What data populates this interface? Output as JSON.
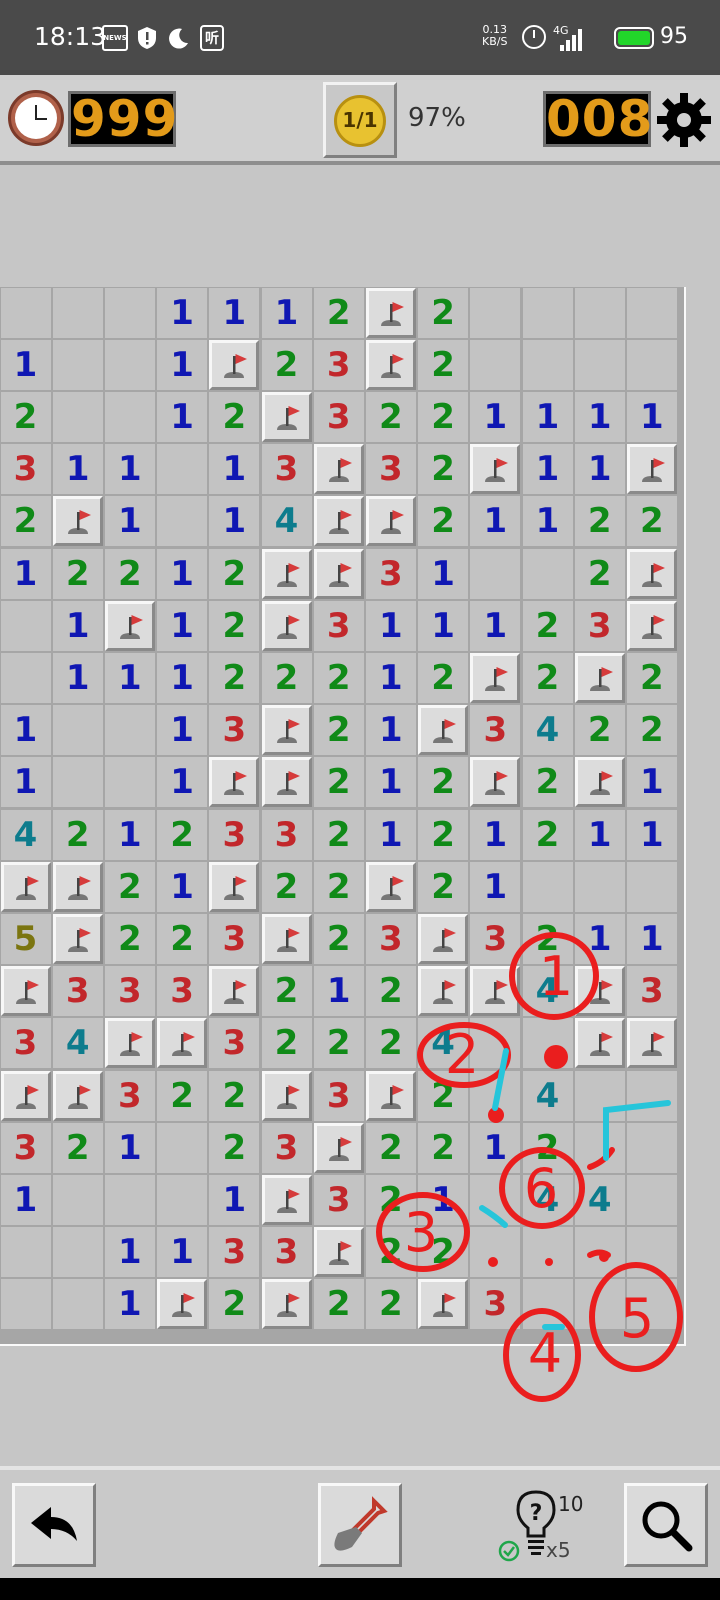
{
  "status_bar": {
    "time": "18:13",
    "news_label": "NEWS",
    "ting_label": "听",
    "net_speed_value": "0.13",
    "net_speed_unit": "KB/S",
    "network_type": "4G",
    "battery": "95"
  },
  "header": {
    "timer": "999",
    "face_label": "1/1",
    "progress": "97%",
    "mines_remaining": "008"
  },
  "colors": {
    "1": "#0f17b3",
    "2": "#108a18",
    "3": "#c2272b",
    "4": "#0d7c8d",
    "5": "#7b7510",
    "lcd_digits": "#e39b1a",
    "annotation_red": "#ea1e1e",
    "annotation_cyan": "#26c5da"
  },
  "board": {
    "rows": [
      [
        "",
        "",
        "",
        "1",
        "1",
        "1",
        "2",
        "F",
        "2",
        "",
        "",
        "",
        ""
      ],
      [
        "1",
        "",
        "",
        "1",
        "F",
        "2",
        "3",
        "F",
        "2",
        "",
        "",
        "",
        ""
      ],
      [
        "2",
        "",
        "",
        "1",
        "2",
        "F",
        "3",
        "2",
        "2",
        "1",
        "1",
        "1",
        "1"
      ],
      [
        "3",
        "1",
        "1",
        "",
        "1",
        "3",
        "F",
        "3",
        "2",
        "F",
        "1",
        "1",
        "F"
      ],
      [
        "2",
        "F",
        "1",
        "",
        "1",
        "4",
        "F",
        "F",
        "2",
        "1",
        "1",
        "2",
        "2"
      ],
      [
        "1",
        "2",
        "2",
        "1",
        "2",
        "F",
        "F",
        "3",
        "1",
        "",
        "",
        "2",
        "F"
      ],
      [
        "",
        "1",
        "F",
        "1",
        "2",
        "F",
        "3",
        "1",
        "1",
        "1",
        "2",
        "3",
        "F"
      ],
      [
        "",
        "1",
        "1",
        "1",
        "2",
        "2",
        "2",
        "1",
        "2",
        "F",
        "2",
        "F",
        "2"
      ],
      [
        "1",
        "",
        "",
        "1",
        "3",
        "F",
        "2",
        "1",
        "F",
        "3",
        "4",
        "2",
        "2"
      ],
      [
        "1",
        "",
        "",
        "1",
        "F",
        "F",
        "2",
        "1",
        "2",
        "F",
        "2",
        "F",
        "1"
      ],
      [
        "4",
        "2",
        "1",
        "2",
        "3",
        "3",
        "2",
        "1",
        "2",
        "1",
        "2",
        "1",
        "1"
      ],
      [
        "F",
        "F",
        "2",
        "1",
        "F",
        "2",
        "2",
        "F",
        "2",
        "1",
        "",
        "",
        ""
      ],
      [
        "5",
        "F",
        "2",
        "2",
        "3",
        "F",
        "2",
        "3",
        "F",
        "3",
        "2",
        "1",
        "1"
      ],
      [
        "F",
        "3",
        "3",
        "3",
        "F",
        "2",
        "1",
        "2",
        "F",
        "F",
        "4",
        "F",
        "3"
      ],
      [
        "3",
        "4",
        "F",
        "F",
        "3",
        "2",
        "2",
        "2",
        "4",
        "",
        "",
        "F",
        "F"
      ],
      [
        "F",
        "F",
        "3",
        "2",
        "2",
        "F",
        "3",
        "F",
        "2",
        "",
        "4",
        "",
        ""
      ],
      [
        "3",
        "2",
        "1",
        "",
        "2",
        "3",
        "F",
        "2",
        "2",
        "1",
        "2",
        "",
        ""
      ],
      [
        "1",
        "",
        "",
        "",
        "1",
        "F",
        "3",
        "2",
        "1",
        "",
        "4",
        "4",
        ""
      ],
      [
        "",
        "",
        "1",
        "1",
        "3",
        "3",
        "F",
        "2",
        "2",
        "",
        "",
        "",
        ""
      ],
      [
        "",
        "",
        "1",
        "F",
        "2",
        "F",
        "2",
        "2",
        "F",
        "3",
        "",
        "",
        ""
      ]
    ]
  },
  "annotations": {
    "labels": [
      "1",
      "2",
      "3",
      "4",
      "5",
      "6"
    ]
  },
  "footer": {
    "hint_count": "10",
    "hint_multiplier": "x5"
  }
}
